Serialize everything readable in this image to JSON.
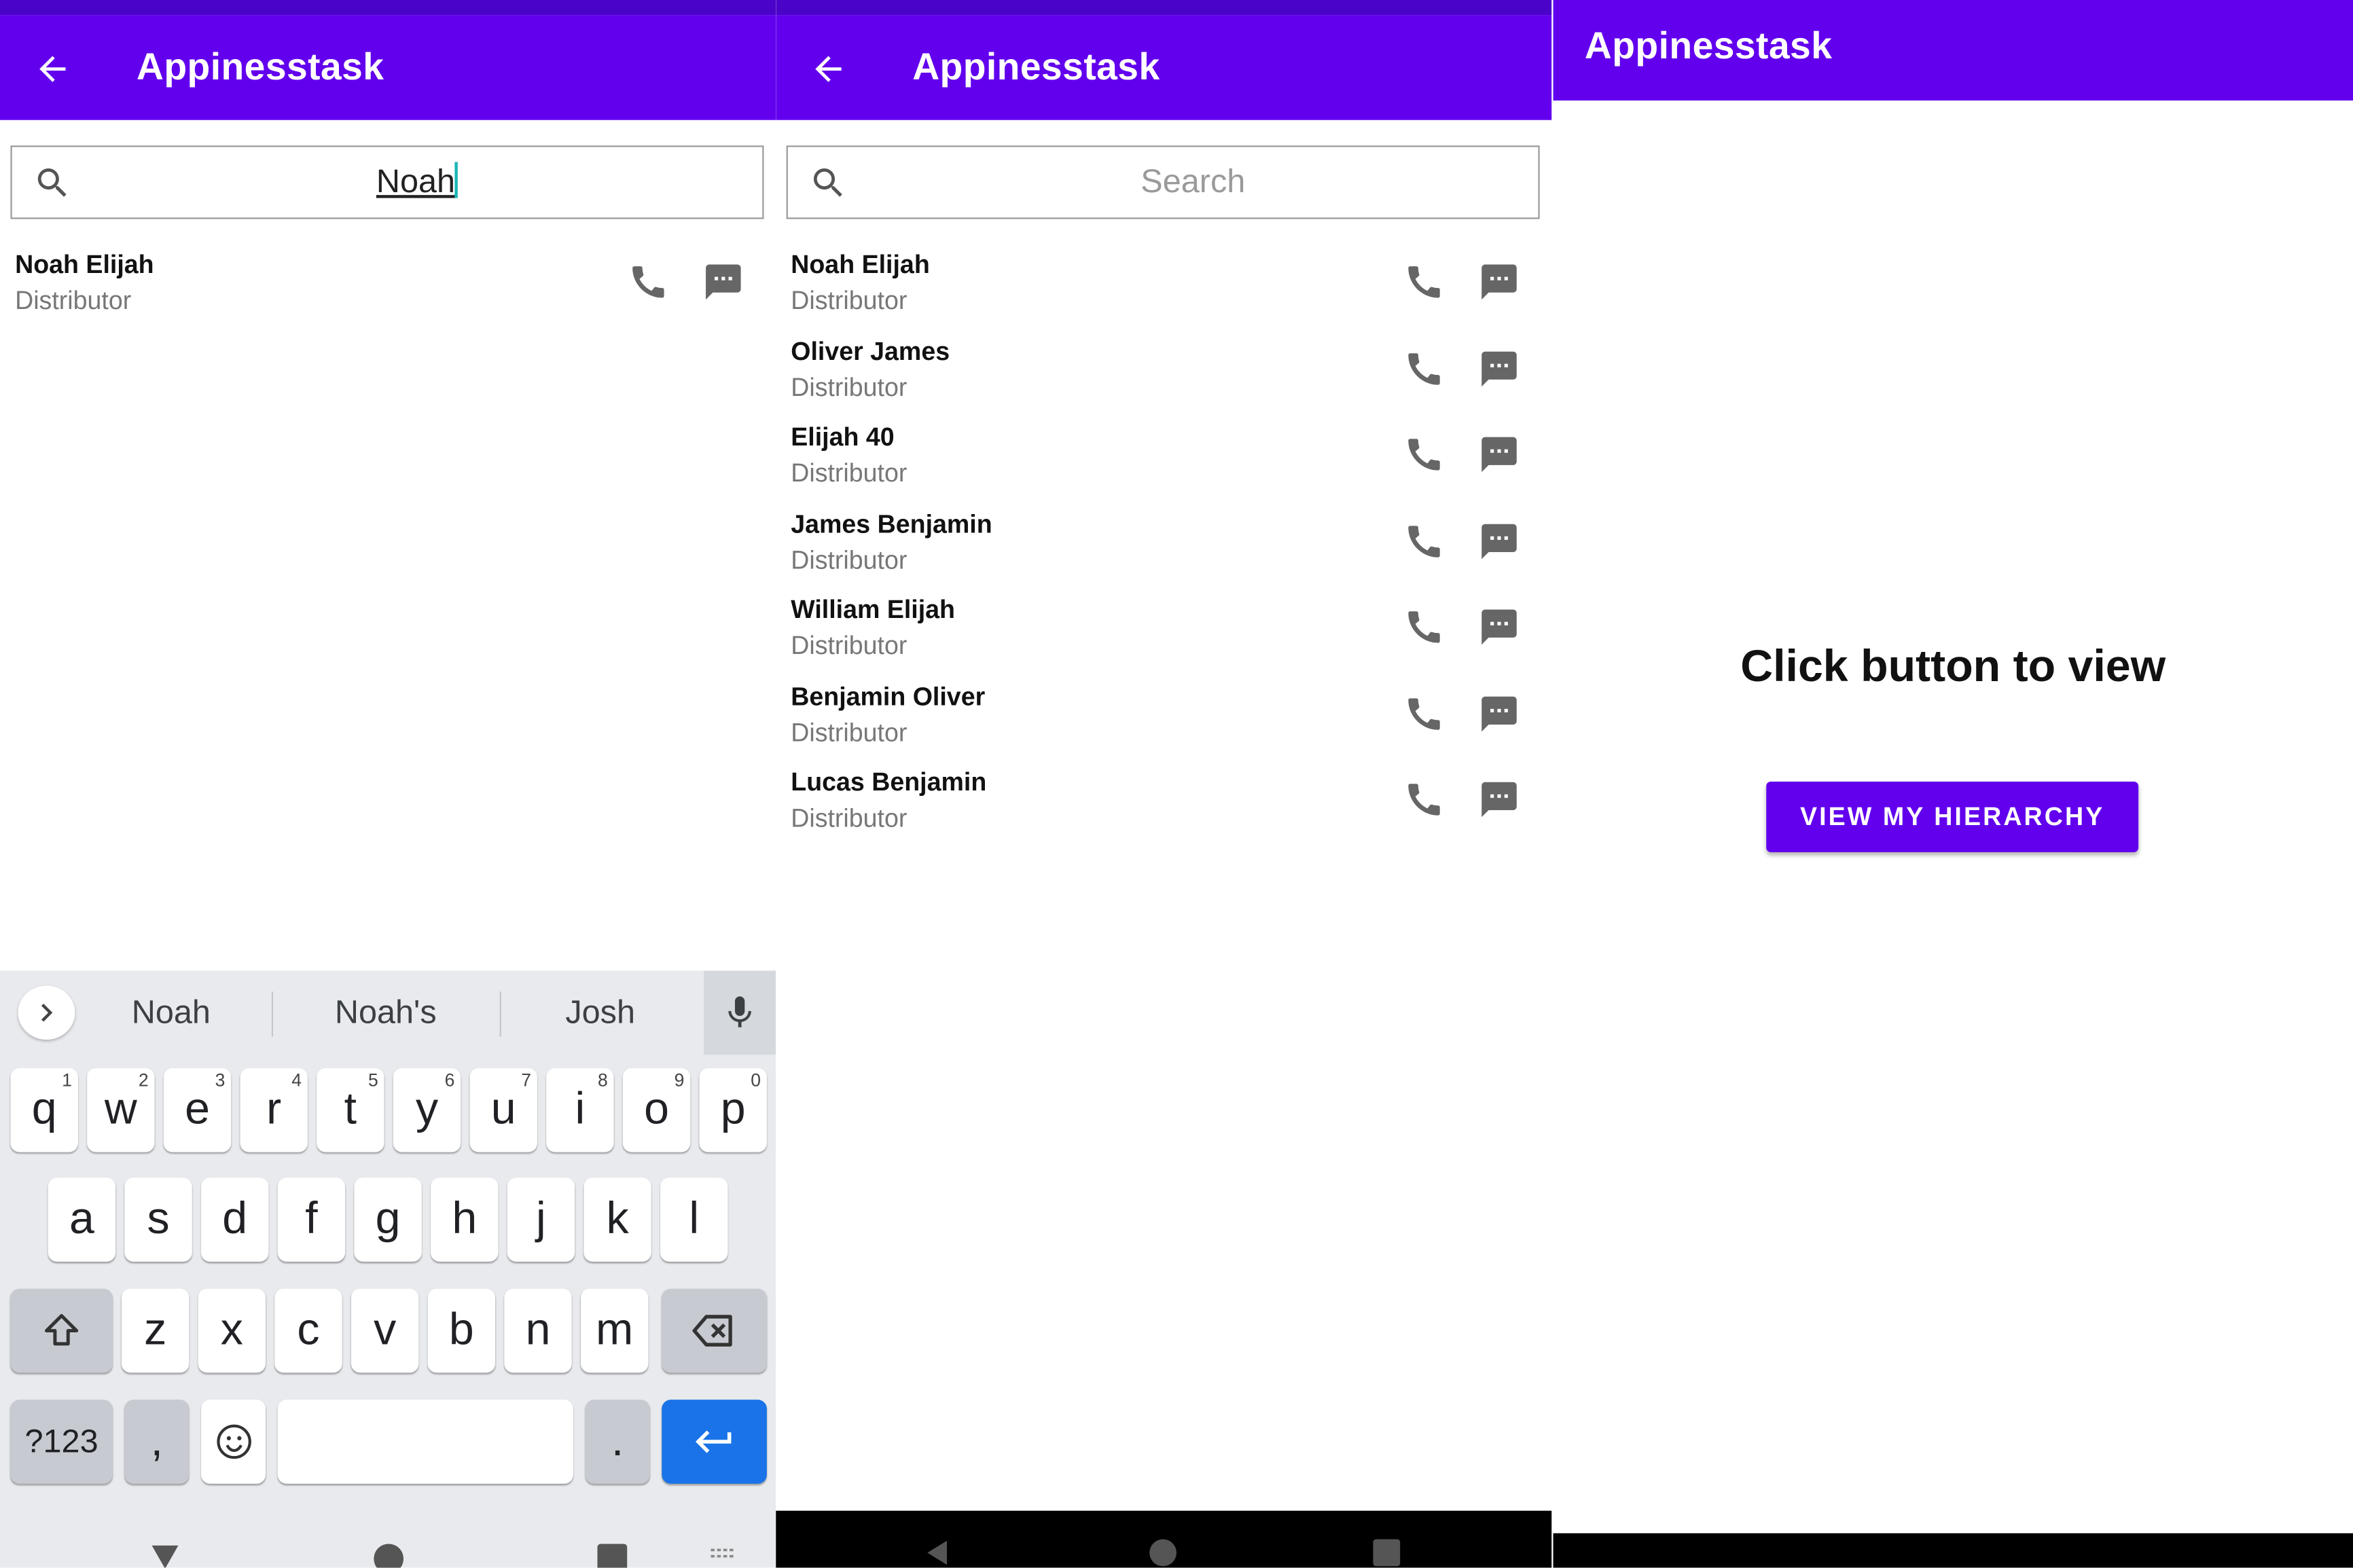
{
  "colors": {
    "primary": "#6200ee",
    "status_bar": "#4a03c9",
    "enter_key": "#1a73e8",
    "cursor": "#19b5b5"
  },
  "screens": [
    {
      "title": "Appinesstask",
      "search": {
        "value": "Noah",
        "placeholder": "Search"
      },
      "contacts": [
        {
          "name": "Noah Elijah",
          "role": "Distributor"
        }
      ],
      "keyboard": {
        "suggestions": [
          "Noah",
          "Noah's",
          "Josh"
        ],
        "row1": [
          "q",
          "w",
          "e",
          "r",
          "t",
          "y",
          "u",
          "i",
          "o",
          "p"
        ],
        "row1_hints": [
          "1",
          "2",
          "3",
          "4",
          "5",
          "6",
          "7",
          "8",
          "9",
          "0"
        ],
        "row2": [
          "a",
          "s",
          "d",
          "f",
          "g",
          "h",
          "j",
          "k",
          "l"
        ],
        "row3": [
          "z",
          "x",
          "c",
          "v",
          "b",
          "n",
          "m"
        ],
        "symbols_key": "?123",
        "comma_key": ",",
        "period_key": "."
      }
    },
    {
      "title": "Appinesstask",
      "search": {
        "value": "",
        "placeholder": "Search"
      },
      "contacts": [
        {
          "name": "Noah Elijah",
          "role": "Distributor"
        },
        {
          "name": "Oliver James",
          "role": "Distributor"
        },
        {
          "name": "Elijah 40",
          "role": "Distributor"
        },
        {
          "name": "James Benjamin",
          "role": "Distributor"
        },
        {
          "name": "William Elijah",
          "role": "Distributor"
        },
        {
          "name": "Benjamin Oliver",
          "role": "Distributor"
        },
        {
          "name": "Lucas Benjamin",
          "role": "Distributor"
        }
      ]
    },
    {
      "title": "Appinesstask",
      "heading": "Click button to view",
      "button_label": "VIEW MY HIERARCHY"
    }
  ]
}
